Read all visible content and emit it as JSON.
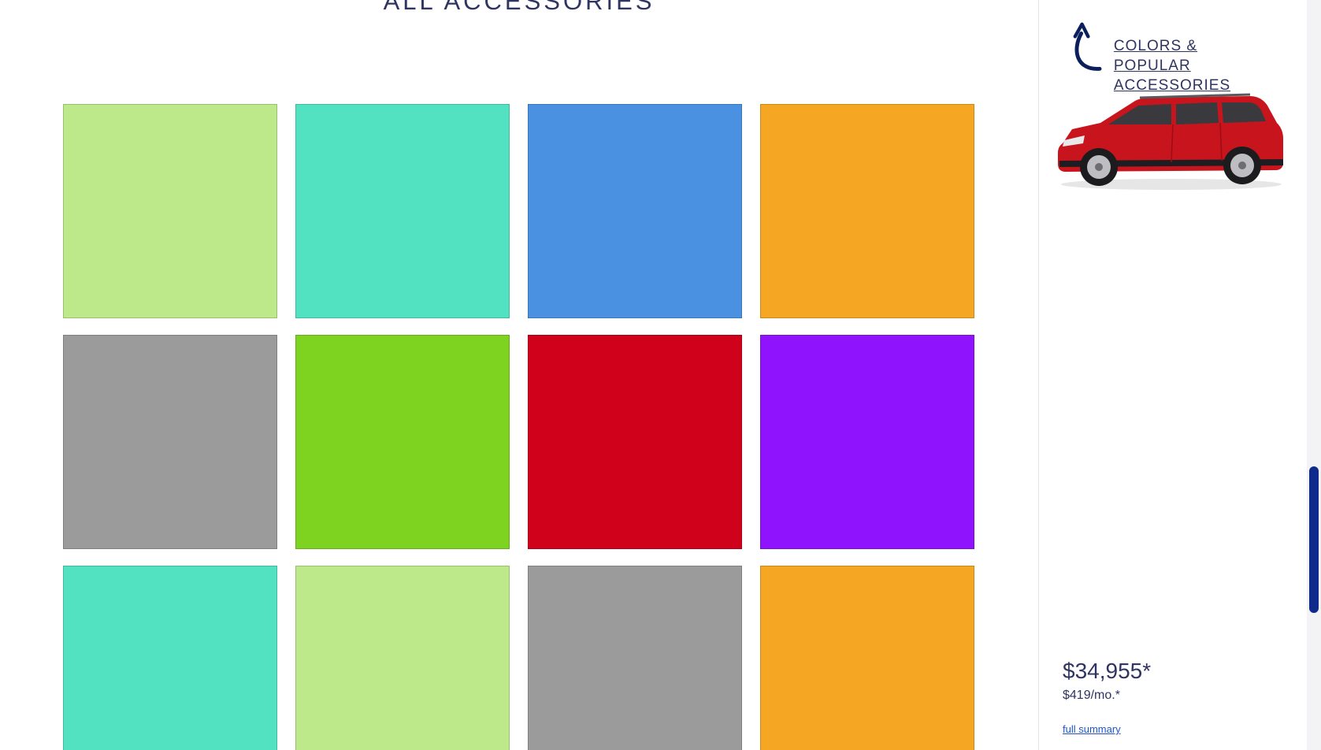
{
  "main": {
    "title": "ALL ACCESSORIES",
    "tiles": [
      {
        "color": "#bde98b"
      },
      {
        "color": "#52e2c1"
      },
      {
        "color": "#4b91e2"
      },
      {
        "color": "#f5a623"
      },
      {
        "color": "#9b9b9b"
      },
      {
        "color": "#7ed321"
      },
      {
        "color": "#d0021b"
      },
      {
        "color": "#9013fe"
      },
      {
        "color": "#52e2c1"
      },
      {
        "color": "#bde98b"
      },
      {
        "color": "#9b9b9b"
      },
      {
        "color": "#f5a623"
      }
    ]
  },
  "sidebar": {
    "back_link": {
      "line1": "COLORS &",
      "line2": "POPULAR ACCESSORIES",
      "icon": "curved-back-arrow-icon"
    },
    "car_image": {
      "name": "red-suv-image",
      "color": "#c8141c"
    },
    "price": "$34,955*",
    "monthly": "$419/mo.*",
    "summary_link": "full summary"
  },
  "colors": {
    "accent": "#2f3560",
    "link": "#1f55c9",
    "scroll_thumb": "#0f2a8a"
  }
}
